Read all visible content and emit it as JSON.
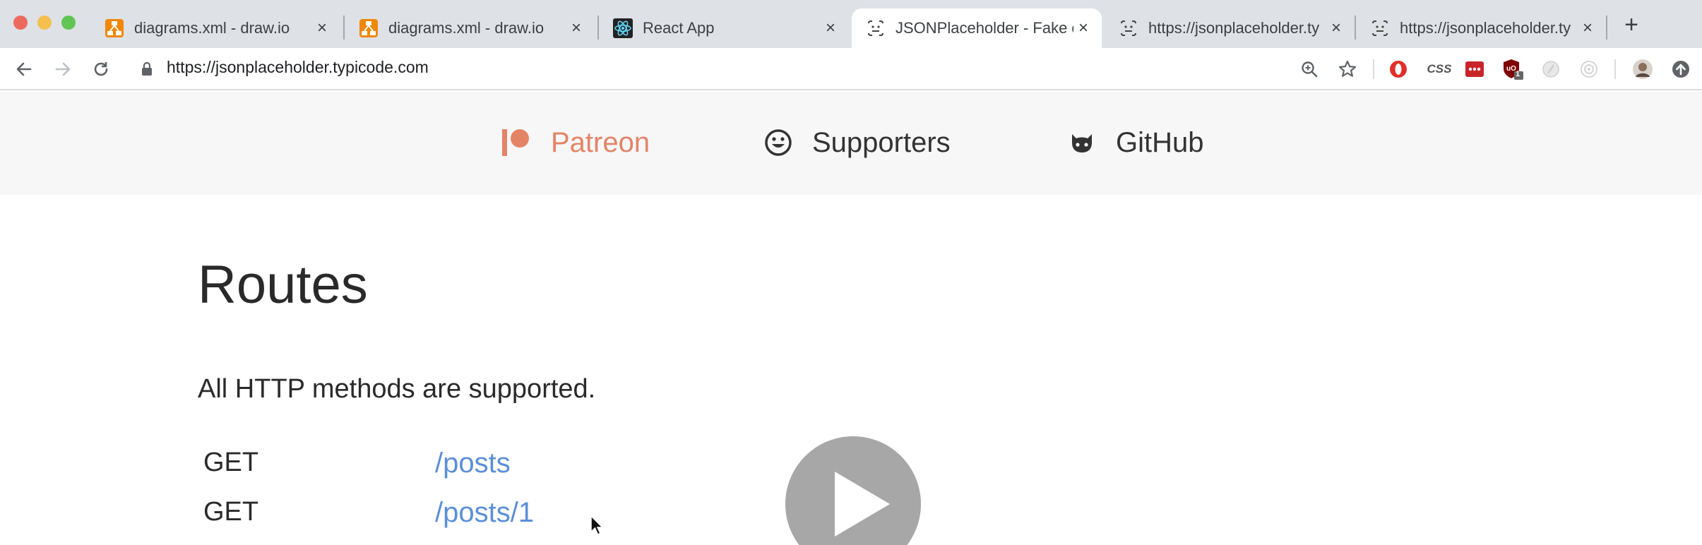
{
  "browser": {
    "tabs": [
      {
        "title": "diagrams.xml - draw.io",
        "favicon": "drawio-icon"
      },
      {
        "title": "diagrams.xml - draw.io",
        "favicon": "drawio-icon"
      },
      {
        "title": "React App",
        "favicon": "react-icon"
      },
      {
        "title": "JSONPlaceholder - Fake o",
        "favicon": "jsonplaceholder-icon",
        "active": true
      },
      {
        "title": "https://jsonplaceholder.ty",
        "favicon": "jsonplaceholder-icon"
      },
      {
        "title": "https://jsonplaceholder.ty",
        "favicon": "jsonplaceholder-icon"
      }
    ],
    "tab_close": "×",
    "new_tab": "+",
    "url": "https://jsonplaceholder.typicode.com",
    "extensions": {
      "css_label": "CSS",
      "badge_count": "1"
    }
  },
  "sponsors": {
    "patreon": "Patreon",
    "supporters": "Supporters",
    "github": "GitHub"
  },
  "main": {
    "heading": "Routes",
    "subtitle": "All HTTP methods are supported.",
    "routes": [
      {
        "method": "GET",
        "path": "/posts"
      },
      {
        "method": "GET",
        "path": "/posts/1"
      }
    ]
  },
  "colors": {
    "patreon_accent": "#e48466",
    "link": "#5b8fd9",
    "tab_strip": "#dee1e6",
    "sponsor_bar": "#f7f7f8"
  }
}
